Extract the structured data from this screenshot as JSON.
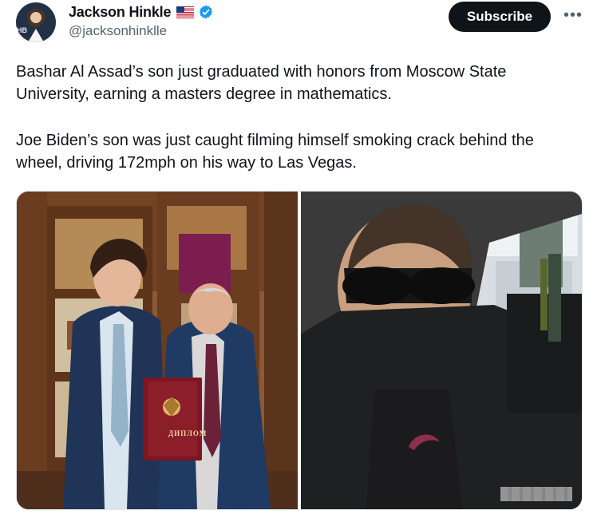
{
  "header": {
    "display_name": "Jackson Hinkle",
    "handle": "@jacksonhinklle",
    "avatar_text": "HB",
    "flag_icon": "us-flag-icon",
    "verified_icon": "verified-badge-icon",
    "subscribe_label": "Subscribe",
    "more_label": "•••"
  },
  "tweet": {
    "paragraph_1": "Bashar Al Assad’s son just graduated with honors from Moscow State University, earning a masters degree in mathematics.",
    "paragraph_2": "Joe Biden’s son was just caught filming himself smoking crack behind the wheel, driving 172mph on his way to Las Vegas."
  },
  "media": {
    "left_diploma_text": "ДИПЛОМ"
  },
  "colors": {
    "text": "#0f1419",
    "muted": "#536471",
    "verified": "#1d9bf0",
    "subscribe_bg": "#0f1419"
  }
}
